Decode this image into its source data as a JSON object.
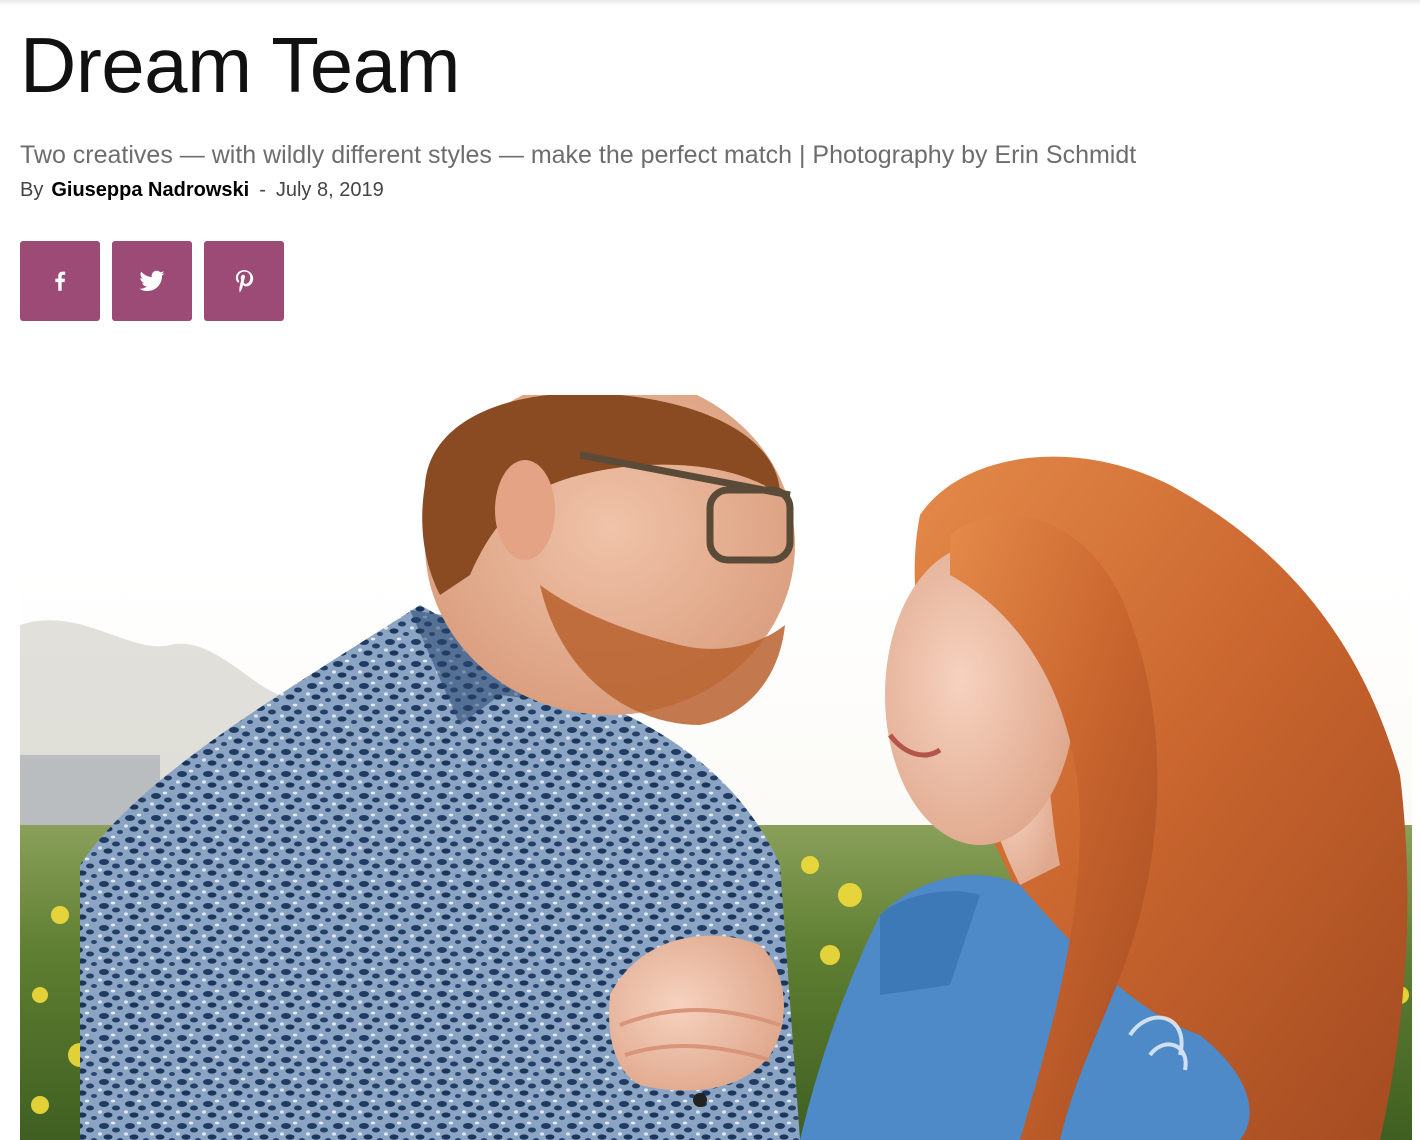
{
  "article": {
    "title": "Dream Team",
    "subtitle": "Two creatives — with wildly different styles — make the perfect match | Photography by Erin Schmidt",
    "byline_prefix": "By",
    "author": "Giuseppa Nadrowski",
    "separator": "-",
    "date": "July 8, 2019"
  },
  "share": {
    "accent_color": "#9c4a76",
    "buttons": [
      {
        "network": "facebook",
        "icon": "facebook-icon"
      },
      {
        "network": "twitter",
        "icon": "twitter-icon"
      },
      {
        "network": "pinterest",
        "icon": "pinterest-icon"
      }
    ]
  },
  "hero_image": {
    "subject": "couple-dancing-in-field-photo"
  }
}
